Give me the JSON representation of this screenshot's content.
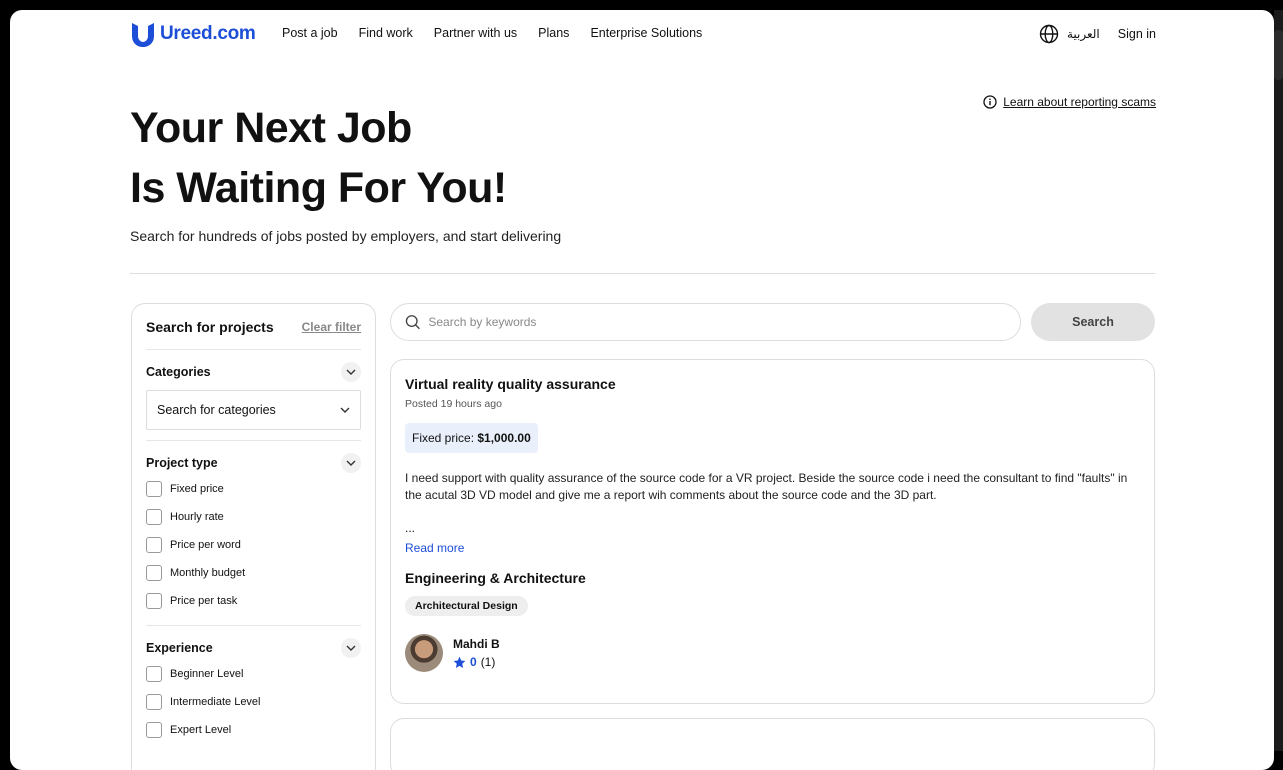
{
  "header": {
    "brand": "Ureed.com",
    "nav": [
      "Post a job",
      "Find work",
      "Partner with us",
      "Plans",
      "Enterprise Solutions"
    ],
    "language": "العربية",
    "sign_in": "Sign in"
  },
  "hero": {
    "title_line1": "Your Next Job",
    "title_line2": "Is Waiting For You!",
    "subtitle": "Search for hundreds of jobs posted by employers, and start delivering",
    "scam_link": "Learn about reporting scams"
  },
  "sidebar": {
    "title": "Search for projects",
    "clear": "Clear filter",
    "categories": {
      "label": "Categories",
      "placeholder": "Search for categories"
    },
    "project_type": {
      "label": "Project type",
      "options": [
        "Fixed price",
        "Hourly rate",
        "Price per word",
        "Monthly budget",
        "Price per task"
      ]
    },
    "experience": {
      "label": "Experience",
      "options": [
        "Beginner Level",
        "Intermediate Level",
        "Expert Level"
      ]
    }
  },
  "search": {
    "placeholder": "Search by keywords",
    "button": "Search"
  },
  "job": {
    "title": "Virtual reality quality assurance",
    "posted": "Posted 19 hours ago",
    "price_label": "Fixed price:",
    "price_value": "$1,000.00",
    "description": "I need support with quality assurance of the source code for a VR project. Beside the source code i need the consultant to find \"faults\" in the acutal 3D VD model and give me a report wih comments about the source code and the 3D part.",
    "ellipsis": "...",
    "read_more": "Read more",
    "category": "Engineering & Architecture",
    "tag": "Architectural Design",
    "user_name": "Mahdi B",
    "rating": "0",
    "reviews": "(1)"
  },
  "colors": {
    "brand": "#1d4ed8",
    "badge_bg": "#e9f0fb"
  }
}
